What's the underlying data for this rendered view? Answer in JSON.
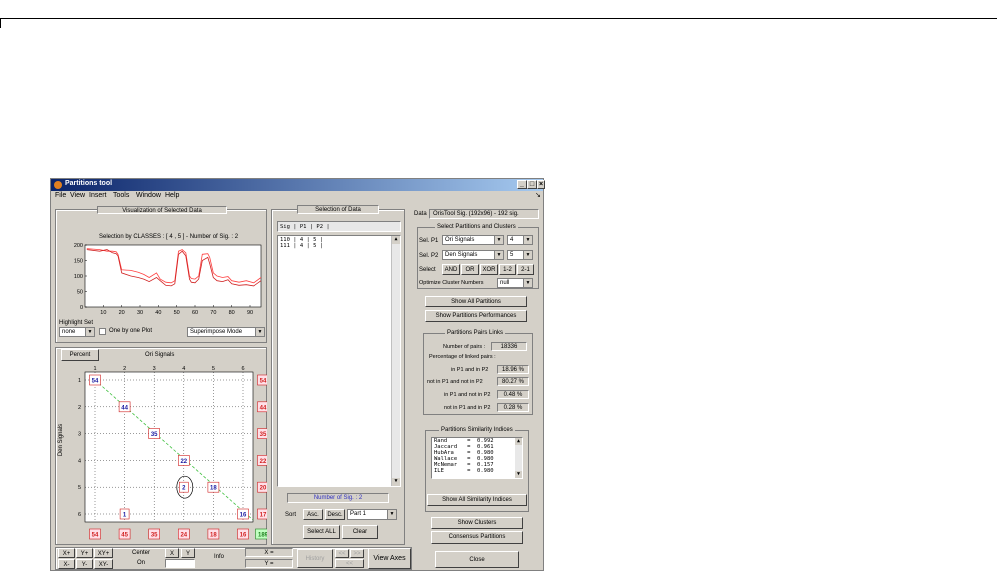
{
  "window": {
    "title": "Partitions tool"
  },
  "menu": [
    "File",
    "View",
    "Insert",
    "Tools",
    "Window",
    "Help"
  ],
  "left": {
    "viz_title": "Visualization of Selected Data",
    "chart_title": "Selection by CLASSES : [ 4 , 5 ] - Number of Sig. : 2",
    "highlight_label": "Highlight Set",
    "highlight_value": "none",
    "one_by_one": "One by one Plot",
    "mode_value": "Superimpose Mode",
    "percent_btn": "Percent",
    "matrix_xlabel": "Ori Signals",
    "matrix_ylabel": "Den Signals",
    "matrix_top_ticks": [
      "1",
      "2",
      "3",
      "4",
      "5",
      "6"
    ],
    "matrix_left_ticks": [
      "1",
      "2",
      "3",
      "4",
      "5",
      "6"
    ],
    "right_col": [
      "54",
      "44",
      "35",
      "22",
      "20",
      "17"
    ],
    "bottom_row": [
      "54",
      "45",
      "35",
      "24",
      "18",
      "16"
    ],
    "cells": [
      {
        "v": "54",
        "r": 1,
        "c": 1
      },
      {
        "v": "44",
        "r": 2,
        "c": 2
      },
      {
        "v": "35",
        "r": 3,
        "c": 3
      },
      {
        "v": "22",
        "r": 4,
        "c": 4
      },
      {
        "v": "2",
        "r": 5,
        "c": 4
      },
      {
        "v": "18",
        "r": 5,
        "c": 5
      },
      {
        "v": "1",
        "r": 6,
        "c": 2
      },
      {
        "v": "16",
        "r": 6,
        "c": 6
      }
    ],
    "total": "189"
  },
  "chart_data": {
    "type": "line",
    "title": "Selection by CLASSES : [ 4 , 5 ] - Number of Sig. : 2",
    "xlim": [
      0,
      96
    ],
    "ylim": [
      0,
      200
    ],
    "x_ticks": [
      "10",
      "20",
      "30",
      "40",
      "50",
      "60",
      "70",
      "80",
      "90"
    ],
    "y_ticks": [
      "0",
      "50",
      "100",
      "150",
      "200"
    ],
    "series": [
      {
        "x": [
          1,
          8,
          12,
          15,
          17,
          18,
          20,
          25,
          29,
          32,
          35,
          39,
          41,
          44,
          47,
          49,
          51,
          53,
          55,
          57,
          58,
          60,
          62,
          64,
          67,
          68,
          70,
          72,
          75,
          78,
          80,
          84,
          88,
          92,
          96
        ],
        "y": [
          188,
          185,
          180,
          180,
          178,
          170,
          120,
          118,
          112,
          105,
          95,
          110,
          90,
          80,
          78,
          85,
          180,
          185,
          175,
          100,
          92,
          90,
          100,
          170,
          172,
          160,
          110,
          100,
          95,
          98,
          85,
          80,
          85,
          78,
          95
        ]
      },
      {
        "x": [
          1,
          8,
          12,
          15,
          17,
          18,
          20,
          25,
          29,
          32,
          35,
          39,
          41,
          44,
          47,
          49,
          51,
          53,
          55,
          57,
          58,
          60,
          62,
          64,
          67,
          68,
          70,
          72,
          75,
          78,
          80,
          84,
          88,
          92,
          96
        ],
        "y": [
          185,
          180,
          185,
          175,
          172,
          165,
          110,
          100,
          95,
          90,
          82,
          95,
          85,
          70,
          68,
          75,
          170,
          180,
          165,
          90,
          80,
          78,
          90,
          150,
          160,
          140,
          95,
          85,
          82,
          88,
          75,
          70,
          72,
          68,
          85
        ]
      }
    ]
  },
  "bottom": {
    "xplus": "X+",
    "yplus": "Y+",
    "xyplus": "XY+",
    "xminus": "X-",
    "yminus": "Y-",
    "xyminus": "XY-",
    "center": "Center",
    "on": "On",
    "x": "X",
    "y": "Y",
    "info": "Info",
    "xeq": "X =",
    "yeq": "Y =",
    "history": "History",
    "view_axes": "View Axes"
  },
  "middle": {
    "title": "Selection of Data",
    "header": "Sig | P1 | P2 |",
    "rows": [
      "110 | 4 | 5 |",
      "111 | 4 | 5 |"
    ],
    "num_sig": "Number of Sig. : 2",
    "sort": "Sort",
    "asc": "Asc.",
    "desc": "Desc.",
    "part": "Part 1",
    "select_all": "Select ALL",
    "clear": "Clear"
  },
  "right": {
    "data_label": "Data",
    "data_value": "OrisTool Sig. (192x96) - 192 sig.",
    "sel_title": "Select Partitions and Clusters",
    "selp1": "Sel. P1",
    "p1_value": "Ori Signals",
    "p1_num": "4",
    "selp2": "Sel. P2",
    "p2_value": "Den Signals",
    "p2_num": "5",
    "select": "Select",
    "ops": [
      "AND",
      "OR",
      "XOR",
      "1-2",
      "2-1"
    ],
    "optimize": "Optimize Cluster Numbers",
    "optimize_value": "null",
    "show_all": "Show All Partitions",
    "show_perf": "Show Partitions Performances",
    "links_title": "Partitions Pairs Links",
    "num_pairs_label": "Number of pairs :",
    "num_pairs": "18336",
    "pct_label": "Percentage of linked pairs :",
    "links": [
      {
        "label": "in P1 and in P2",
        "value": "18.96 %"
      },
      {
        "label": "not in P1 and not in P2",
        "value": "80.27 %"
      },
      {
        "label": "in P1 and not in P2",
        "value": "0.48 %"
      },
      {
        "label": "not in P1 and in P2",
        "value": "0.28 %"
      }
    ],
    "sim_title": "Partitions Similarity Indices",
    "sim": [
      "Rand      =  0.992",
      "Jaccard   =  0.961",
      "HubAra    =  0.980",
      "Wallace   =  0.980",
      "McNemar   =  0.157",
      "ILE       =  0.980"
    ],
    "show_sim": "Show All Similarity Indices",
    "show_clusters": "Show Clusters",
    "consensus": "Consensus Partitions",
    "close": "Close"
  }
}
